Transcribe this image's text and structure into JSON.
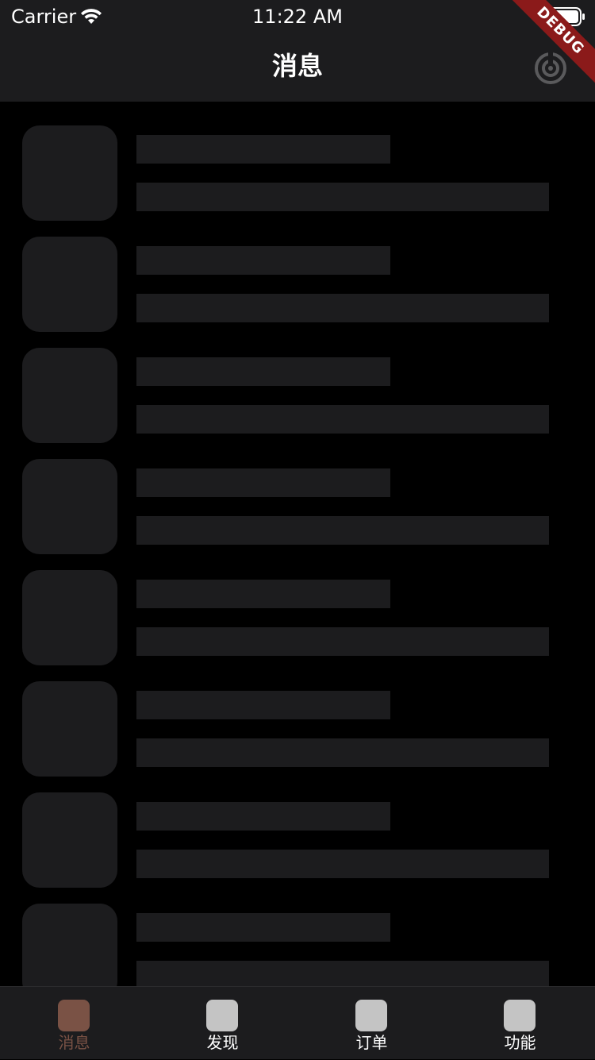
{
  "status_bar": {
    "carrier": "Carrier",
    "time": "11:22 AM",
    "wifi_icon": "wifi-icon",
    "battery_icon": "battery-icon"
  },
  "nav": {
    "title": "消息",
    "action_icon": "radar-icon"
  },
  "debug_banner": "DEBUG",
  "list": {
    "placeholder_rows": 8,
    "placeholder_color": "#1c1c1e"
  },
  "tab_bar": {
    "active_color": "#7a5245",
    "inactive_icon_color": "#c4c4c4",
    "tabs": [
      {
        "label": "消息",
        "active": true
      },
      {
        "label": "发现",
        "active": false
      },
      {
        "label": "订单",
        "active": false
      },
      {
        "label": "功能",
        "active": false
      }
    ]
  }
}
